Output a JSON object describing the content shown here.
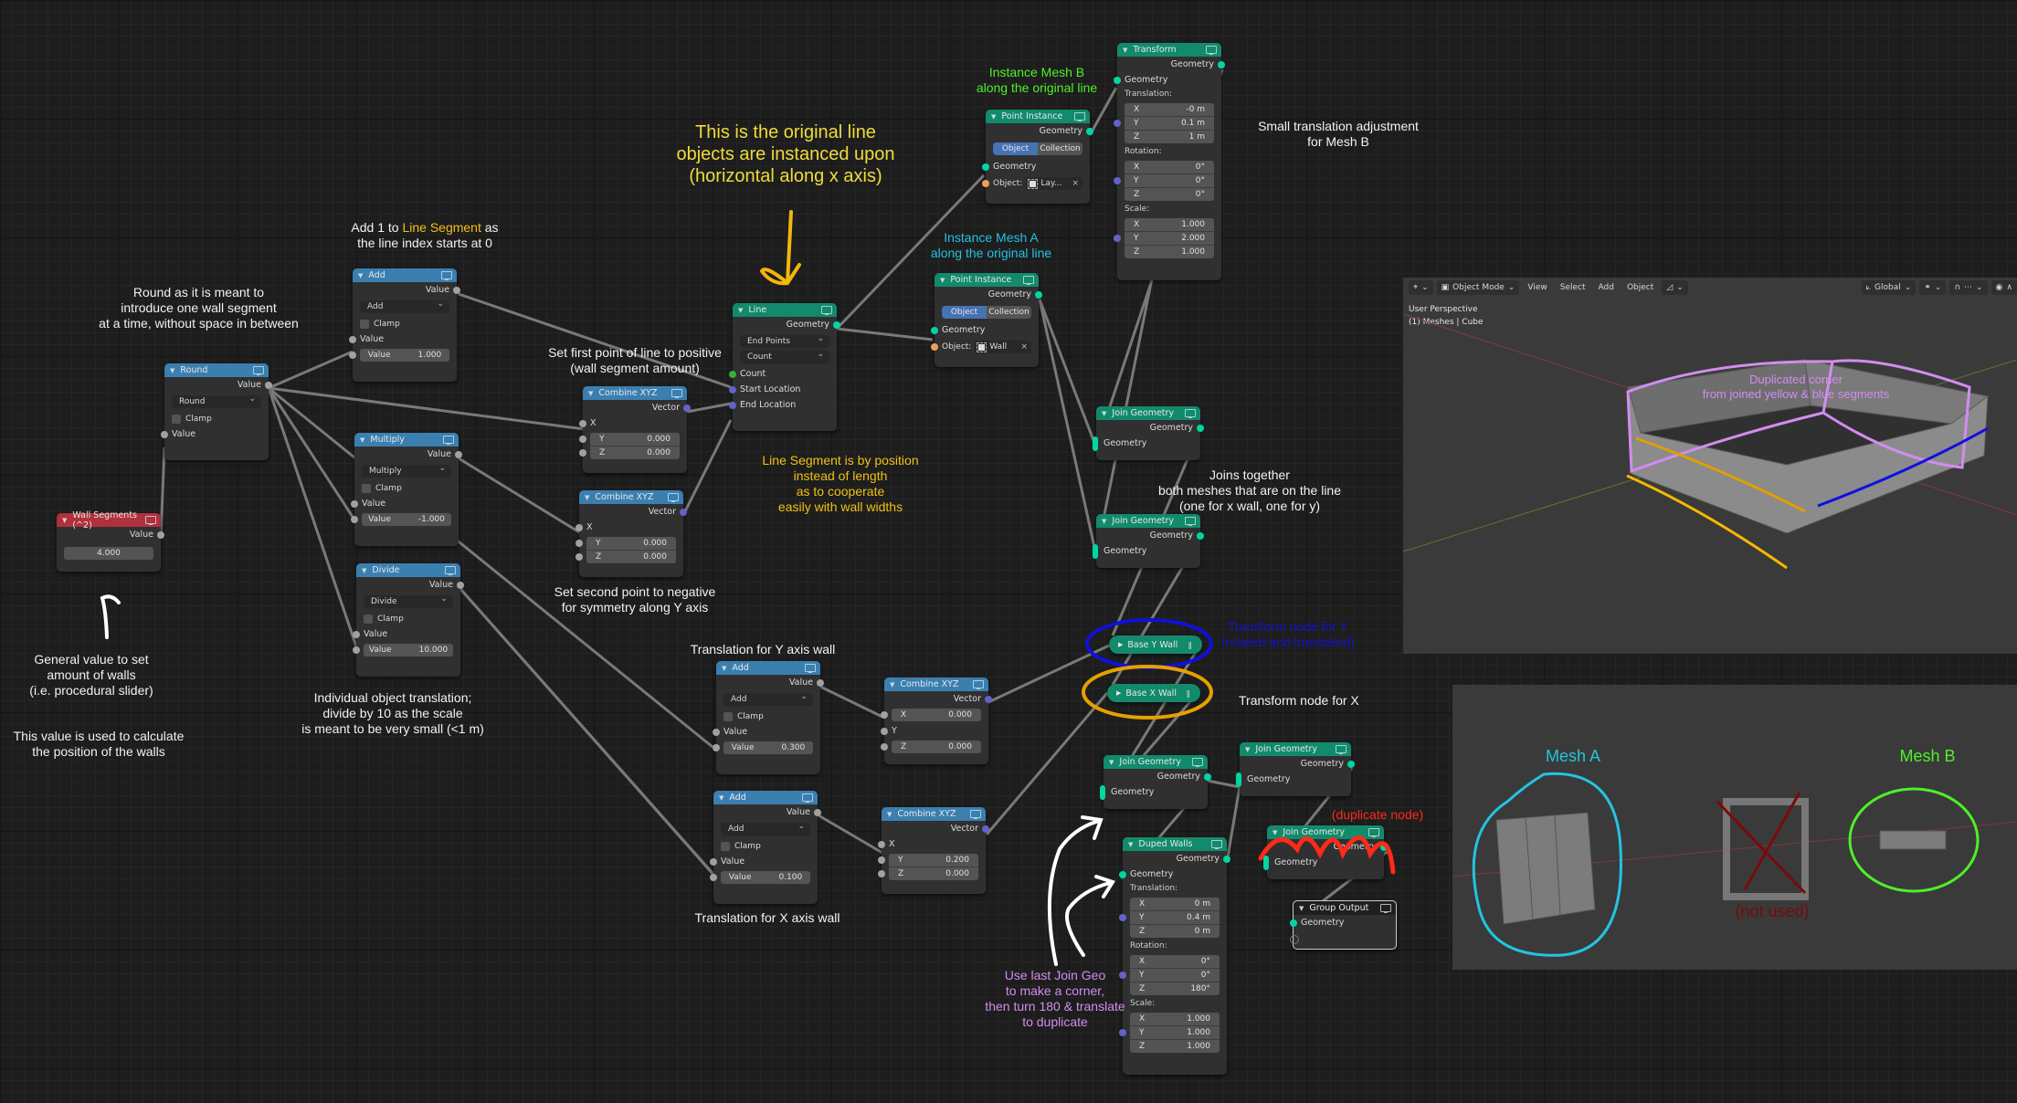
{
  "app": "Blender - Geometry Nodes",
  "nodes": {
    "wall_segments": {
      "title": "Wall Segments (^2)",
      "output": "Value",
      "value": "4.000"
    },
    "round": {
      "title": "Round",
      "output": "Value",
      "operation": "Round",
      "clamp": "Clamp",
      "input": "Value"
    },
    "add1": {
      "title": "Add",
      "output": "Value",
      "operation": "Add",
      "clamp": "Clamp",
      "input": "Value",
      "value_label": "Value",
      "value": "1.000"
    },
    "multiply": {
      "title": "Multiply",
      "output": "Value",
      "operation": "Multiply",
      "clamp": "Clamp",
      "input": "Value",
      "value_label": "Value",
      "value": "-1.000"
    },
    "divide": {
      "title": "Divide",
      "output": "Value",
      "operation": "Divide",
      "clamp": "Clamp",
      "input": "Value",
      "value_label": "Value",
      "value": "10.000"
    },
    "combine1": {
      "title": "Combine XYZ",
      "output": "Vector",
      "x_label": "X",
      "y_label": "Y",
      "y": "0.000",
      "z_label": "Z",
      "z": "0.000"
    },
    "combine2": {
      "title": "Combine XYZ",
      "output": "Vector",
      "x_label": "X",
      "y_label": "Y",
      "y": "0.000",
      "z_label": "Z",
      "z": "0.000"
    },
    "line": {
      "title": "Line",
      "output": "Geometry",
      "mode": "End Points",
      "count_mode": "Count",
      "inputs": [
        "Count",
        "Start Location",
        "End Location"
      ]
    },
    "point_instance_a": {
      "title": "Point Instance",
      "output": "Geometry",
      "tab_object": "Object",
      "tab_collection": "Collection",
      "input": "Geometry",
      "object_label": "Object:",
      "object": "Wall"
    },
    "point_instance_b": {
      "title": "Point Instance",
      "output": "Geometry",
      "tab_object": "Object",
      "tab_collection": "Collection",
      "input": "Geometry",
      "object_label": "Object:",
      "object": "Lay..."
    },
    "transform": {
      "title": "Transform",
      "output": "Geometry",
      "input": "Geometry",
      "translation_label": "Translation:",
      "translation": [
        [
          "X",
          "-0 m"
        ],
        [
          "Y",
          "0.1 m"
        ],
        [
          "Z",
          "1 m"
        ]
      ],
      "rotation_label": "Rotation:",
      "rotation": [
        [
          "X",
          "0°"
        ],
        [
          "Y",
          "0°"
        ],
        [
          "Z",
          "0°"
        ]
      ],
      "scale_label": "Scale:",
      "scale": [
        [
          "X",
          "1.000"
        ],
        [
          "Y",
          "2.000"
        ],
        [
          "Z",
          "1.000"
        ]
      ]
    },
    "join1": {
      "title": "Join Geometry",
      "output": "Geometry",
      "input": "Geometry"
    },
    "join2": {
      "title": "Join Geometry",
      "output": "Geometry",
      "input": "Geometry"
    },
    "base_y_wall": {
      "title": "Base Y Wall"
    },
    "base_x_wall": {
      "title": "Base X Wall"
    },
    "add_y": {
      "title": "Add",
      "output": "Value",
      "operation": "Add",
      "clamp": "Clamp",
      "input": "Value",
      "value_label": "Value",
      "value": "0.300"
    },
    "add_x": {
      "title": "Add",
      "output": "Value",
      "operation": "Add",
      "clamp": "Clamp",
      "input": "Value",
      "value_label": "Value",
      "value": "0.100"
    },
    "combine_y": {
      "title": "Combine XYZ",
      "output": "Vector",
      "x_label": "X",
      "x": "0.000",
      "y_label": "Y",
      "z_label": "Z",
      "z": "0.000"
    },
    "combine_x": {
      "title": "Combine XYZ",
      "output": "Vector",
      "x_label": "X",
      "y_label": "Y",
      "y": "0.200",
      "z_label": "Z",
      "z": "0.000"
    },
    "join3": {
      "title": "Join Geometry",
      "output": "Geometry",
      "input": "Geometry"
    },
    "join4": {
      "title": "Join Geometry",
      "output": "Geometry",
      "input": "Geometry"
    },
    "join5": {
      "title": "Join Geometry",
      "output": "Geometry",
      "input": "Geometry"
    },
    "duped_walls": {
      "title": "Duped Walls",
      "output": "Geometry",
      "input": "Geometry",
      "translation_label": "Translation:",
      "translation": [
        [
          "X",
          "0 m"
        ],
        [
          "Y",
          "0.4 m"
        ],
        [
          "Z",
          "0 m"
        ]
      ],
      "rotation_label": "Rotation:",
      "rotation": [
        [
          "X",
          "0°"
        ],
        [
          "Y",
          "0°"
        ],
        [
          "Z",
          "180°"
        ]
      ],
      "scale_label": "Scale:",
      "scale": [
        [
          "X",
          "1.000"
        ],
        [
          "Y",
          "1.000"
        ],
        [
          "Z",
          "1.000"
        ]
      ]
    },
    "group_output": {
      "title": "Group Output",
      "input": "Geometry"
    }
  },
  "annotations": {
    "general_value": [
      "General value to set",
      "amount of walls",
      "(i.e. procedural slider)"
    ],
    "general_value_2": [
      "This value is used to calculate",
      "the position of the walls"
    ],
    "round_note": [
      "Round as it is meant to",
      "introduce one wall segment",
      "at a time, without space in between"
    ],
    "add1_note_a": "Add 1 to ",
    "add1_note_highlight": "Line Segment",
    "add1_note_b": " as",
    "add1_note_c": "the line index starts at 0",
    "first_point": [
      "Set first point of line to positive",
      "(wall segment amount)"
    ],
    "second_point": [
      "Set second point to negative",
      "for symmetry along Y axis"
    ],
    "divide_note": [
      "Individual object translation;",
      "divide by 10 as the scale",
      "is meant to be very small (<1 m)"
    ],
    "original_line": [
      "This is the original line",
      "objects are instanced upon",
      "(horizontal along x axis)"
    ],
    "line_segment": [
      "Line Segment is by position",
      "instead of length",
      "as to cooperate",
      "easily with wall widths"
    ],
    "instance_a": [
      "Instance Mesh A",
      "along the original line"
    ],
    "instance_b": [
      "Instance Mesh B",
      "along the original line"
    ],
    "small_translation": [
      "Small translation adjustment",
      "for Mesh B"
    ],
    "joins_together": [
      "Joins together",
      "both meshes that are on the line",
      "(one for x wall, one for y)"
    ],
    "transform_y": [
      "Transform node for Y",
      "(rotated and translated)"
    ],
    "transform_x": "Transform node for X",
    "translation_y": "Translation for Y axis wall",
    "translation_x": "Translation for X axis wall",
    "duplicate_node": "(duplicate node)",
    "use_last_join": [
      "Use last Join Geo",
      "to make a corner,",
      "then turn 180 & translate",
      "to duplicate"
    ]
  },
  "viewport_top": {
    "mode": "Object Mode",
    "menus": [
      "View",
      "Select",
      "Add",
      "Object"
    ],
    "orientation": "Global",
    "perspective": "User Perspective",
    "collection": "(1) Meshes | Cube",
    "note": [
      "Duplicated corner",
      "from joined yellow & blue segments"
    ]
  },
  "viewport_bottom": {
    "mesh_a": "Mesh A",
    "mesh_b": "Mesh B",
    "not_used": "(not used)"
  },
  "colors": {
    "math_header": "#3b7fb0",
    "geometry_header": "#128a6c",
    "input_header": "#b0303c",
    "geometry_socket": "#00d6a3",
    "vector_socket": "#6363c7"
  }
}
